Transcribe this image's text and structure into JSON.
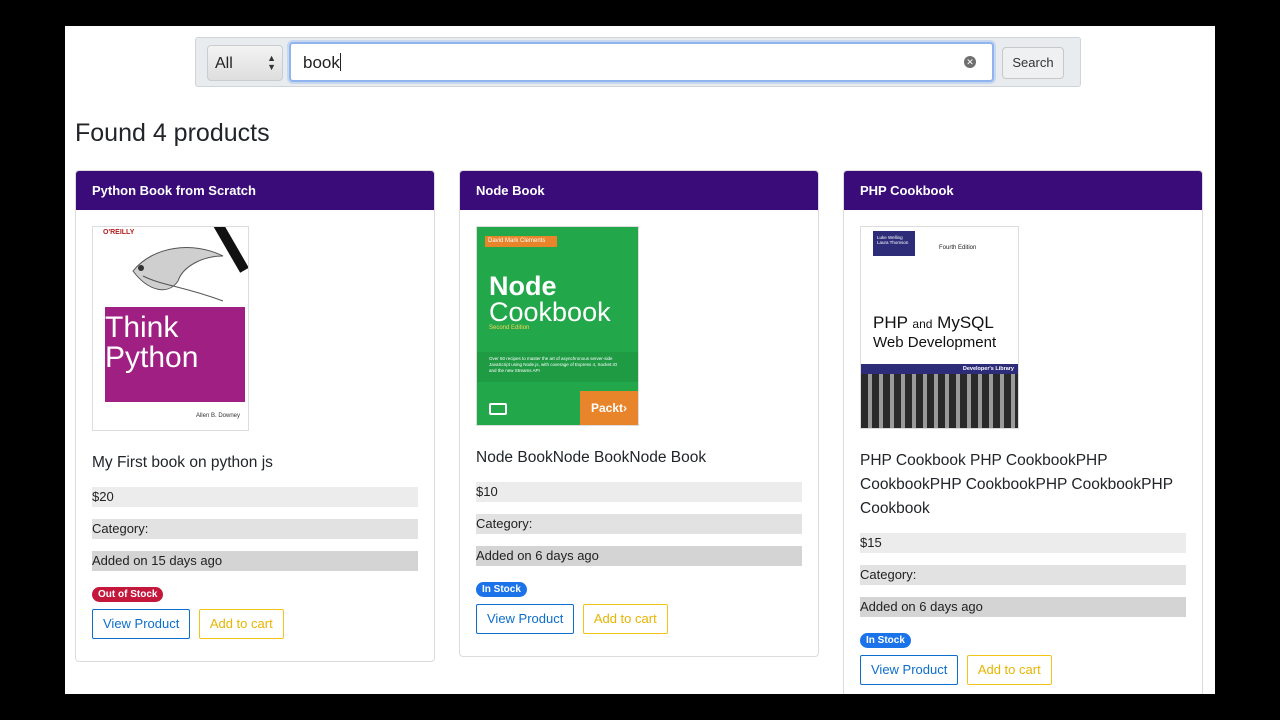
{
  "search": {
    "category_value": "All",
    "query": "book",
    "button_label": "Search"
  },
  "results_heading": "Found 4 products",
  "products": [
    {
      "title": "Python Book from Scratch",
      "description": "My First book on python js",
      "price": "$20",
      "category": "Category:",
      "added": "Added on 15 days ago",
      "stock_label": "Out of Stock",
      "view_label": "View Product",
      "cart_label": "Add to cart",
      "cover": {
        "publisher": "O'REILLY",
        "title_line1": "Think",
        "title_line2": "Python",
        "author": "Allen B. Downey"
      }
    },
    {
      "title": "Node Book",
      "description": "Node BookNode BookNode Book",
      "price": "$10",
      "category": "Category:",
      "added": "Added on 6 days ago",
      "stock_label": "In Stock",
      "view_label": "View Product",
      "cart_label": "Add to cart",
      "cover": {
        "author": "David Mark Clements",
        "title_line1": "Node",
        "title_line2": "Cookbook",
        "edition": "Second Edition",
        "blurb": "Over 50 recipes to master the art of asynchronous server-side JavaScript using Node.js, with coverage of Express 4, Socket.IO and the new Streams API",
        "publisher": "Packt›"
      }
    },
    {
      "title": "PHP Cookbook",
      "description": "PHP Cookbook PHP CookbookPHP CookbookPHP CookbookPHP CookbookPHP Cookbook",
      "price": "$15",
      "category": "Category:",
      "added": "Added on 6 days ago",
      "stock_label": "In Stock",
      "view_label": "View Product",
      "cart_label": "Add to cart",
      "cover": {
        "authors": "Luke Welling Laura Thomson",
        "edition": "Fourth Edition",
        "title_main": "PHP",
        "title_and": "and",
        "title_mysql": "MySQL",
        "title_line2": "Web Development",
        "series": "Developer's Library"
      }
    }
  ],
  "colors": {
    "card_header": "#3a0c7a",
    "out_of_stock": "#c3173c",
    "in_stock": "#1a73e8",
    "view_button": "#0d6ecd",
    "cart_button": "#f0c419"
  }
}
